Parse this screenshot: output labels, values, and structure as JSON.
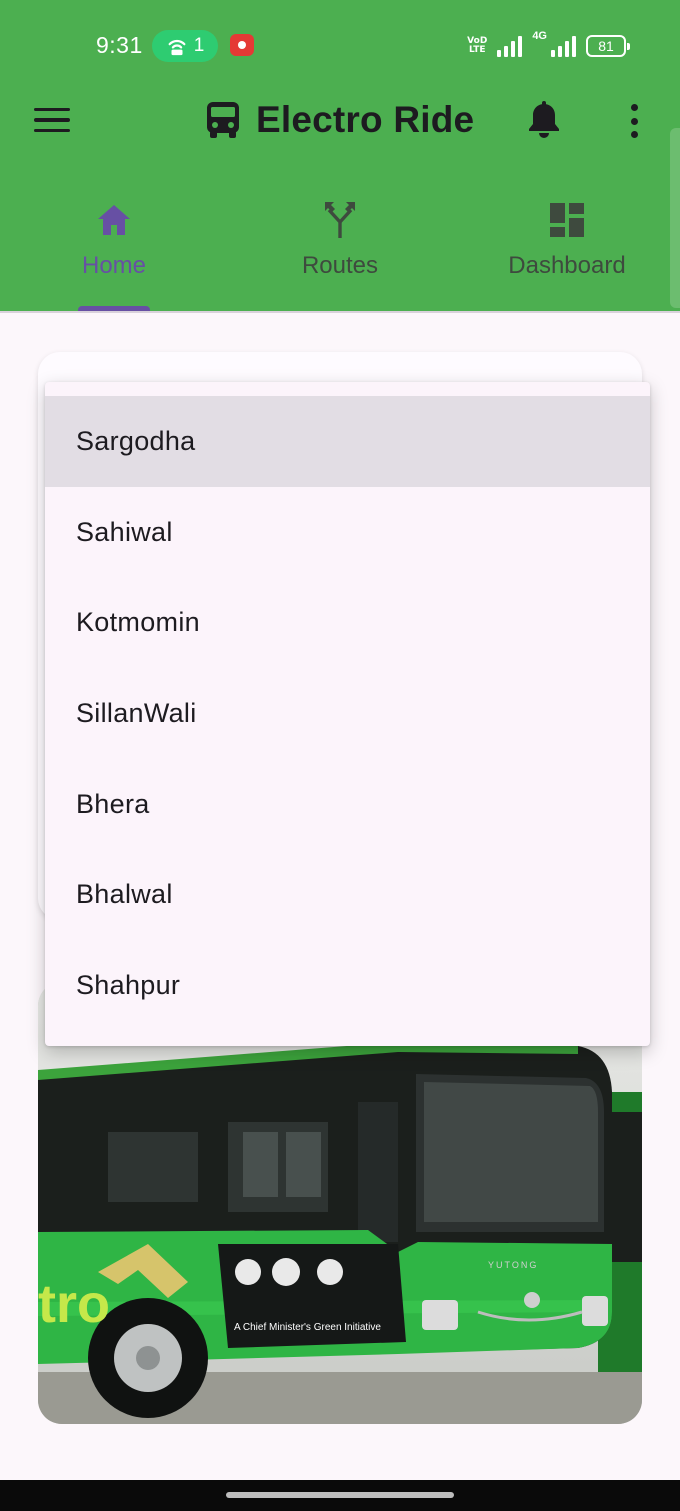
{
  "status_bar": {
    "time": "9:31",
    "hotspot_count": "1",
    "volte": [
      "VoD",
      "LTE"
    ],
    "network": "4G",
    "battery": "81"
  },
  "app_bar": {
    "title": "Electro Ride",
    "icons": [
      "menu-icon",
      "bus-icon",
      "bell-icon",
      "more-vert-icon"
    ]
  },
  "tabs": [
    {
      "label": "Home",
      "icon": "home-icon",
      "active": true
    },
    {
      "label": "Routes",
      "icon": "fork-icon",
      "active": false
    },
    {
      "label": "Dashboard",
      "icon": "dashboard-icon",
      "active": false
    }
  ],
  "dropdown": {
    "options": [
      "Sargodha",
      "Sahiwal",
      "Kotmomin",
      "SillanWali",
      "Bhera",
      "Bhalwal",
      "Shahpur"
    ],
    "highlighted": "Sargodha"
  },
  "bus_image": {
    "text": "A Chief Minister's Green Initiative",
    "brand": "YUTONG"
  },
  "colors": {
    "app_bar_green": "#4caf50",
    "accent_purple": "#6750a4",
    "background": "#fcf7fb"
  }
}
